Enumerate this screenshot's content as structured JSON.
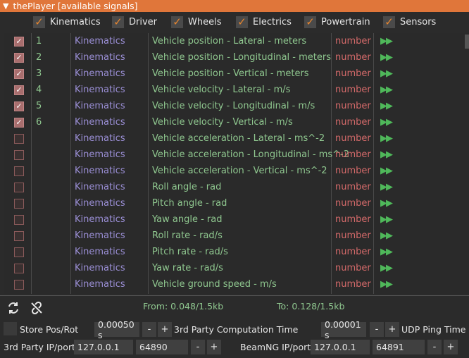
{
  "window": {
    "title": "thePlayer [available signals]"
  },
  "filters": [
    {
      "label": "Kinematics",
      "checked": true
    },
    {
      "label": "Driver",
      "checked": true
    },
    {
      "label": "Wheels",
      "checked": true
    },
    {
      "label": "Electrics",
      "checked": true
    },
    {
      "label": "Powertrain",
      "checked": true
    },
    {
      "label": "Sensors",
      "checked": true
    }
  ],
  "signals": [
    {
      "checked": true,
      "index": "1",
      "group": "Kinematics",
      "name": "Vehicle position - Lateral - meters",
      "type": "number"
    },
    {
      "checked": true,
      "index": "2",
      "group": "Kinematics",
      "name": "Vehicle position - Longitudinal - meters",
      "type": "number"
    },
    {
      "checked": true,
      "index": "3",
      "group": "Kinematics",
      "name": "Vehicle position - Vertical - meters",
      "type": "number"
    },
    {
      "checked": true,
      "index": "4",
      "group": "Kinematics",
      "name": "Vehicle velocity - Lateral - m/s",
      "type": "number"
    },
    {
      "checked": true,
      "index": "5",
      "group": "Kinematics",
      "name": "Vehicle velocity - Longitudinal - m/s",
      "type": "number"
    },
    {
      "checked": true,
      "index": "6",
      "group": "Kinematics",
      "name": "Vehicle velocity - Vertical - m/s",
      "type": "number"
    },
    {
      "checked": false,
      "index": "",
      "group": "Kinematics",
      "name": "Vehicle acceleration - Lateral - ms^-2",
      "type": "number"
    },
    {
      "checked": false,
      "index": "",
      "group": "Kinematics",
      "name": "Vehicle acceleration - Longitudinal - ms^-2",
      "type": "number"
    },
    {
      "checked": false,
      "index": "",
      "group": "Kinematics",
      "name": "Vehicle acceleration - Vertical - ms^-2",
      "type": "number"
    },
    {
      "checked": false,
      "index": "",
      "group": "Kinematics",
      "name": "Roll angle - rad",
      "type": "number"
    },
    {
      "checked": false,
      "index": "",
      "group": "Kinematics",
      "name": "Pitch angle - rad",
      "type": "number"
    },
    {
      "checked": false,
      "index": "",
      "group": "Kinematics",
      "name": "Yaw angle - rad",
      "type": "number"
    },
    {
      "checked": false,
      "index": "",
      "group": "Kinematics",
      "name": "Roll rate - rad/s",
      "type": "number"
    },
    {
      "checked": false,
      "index": "",
      "group": "Kinematics",
      "name": "Pitch rate - rad/s",
      "type": "number"
    },
    {
      "checked": false,
      "index": "",
      "group": "Kinematics",
      "name": "Yaw rate - rad/s",
      "type": "number"
    },
    {
      "checked": false,
      "index": "",
      "group": "Kinematics",
      "name": "Vehicle ground speed - m/s",
      "type": "number"
    }
  ],
  "status": {
    "from": "From: 0.048/1.5kb",
    "to": "To: 0.128/1.5kb"
  },
  "controls": {
    "store_pos_rot": "Store Pos/Rot",
    "computation_time_value": "0.00050 s",
    "computation_time_label": "3rd Party Computation Time",
    "udp_ping_value": "0.00001 s",
    "udp_ping_label": "UDP Ping Time",
    "third_party_label": "3rd Party IP/port:",
    "third_party_ip": "127.0.0.1",
    "third_party_port": "64890",
    "beamng_label": "BeamNG IP/port:",
    "beamng_ip": "127.0.0.1",
    "beamng_port": "64891",
    "minus": "-",
    "plus": "+"
  },
  "colors": {
    "titlebar": "#e0763a",
    "accent_check": "#e8862f",
    "index_text": "#8fc78f",
    "group_text": "#9b8fd6",
    "type_text": "#d46a6a",
    "play": "#4fb85a"
  }
}
